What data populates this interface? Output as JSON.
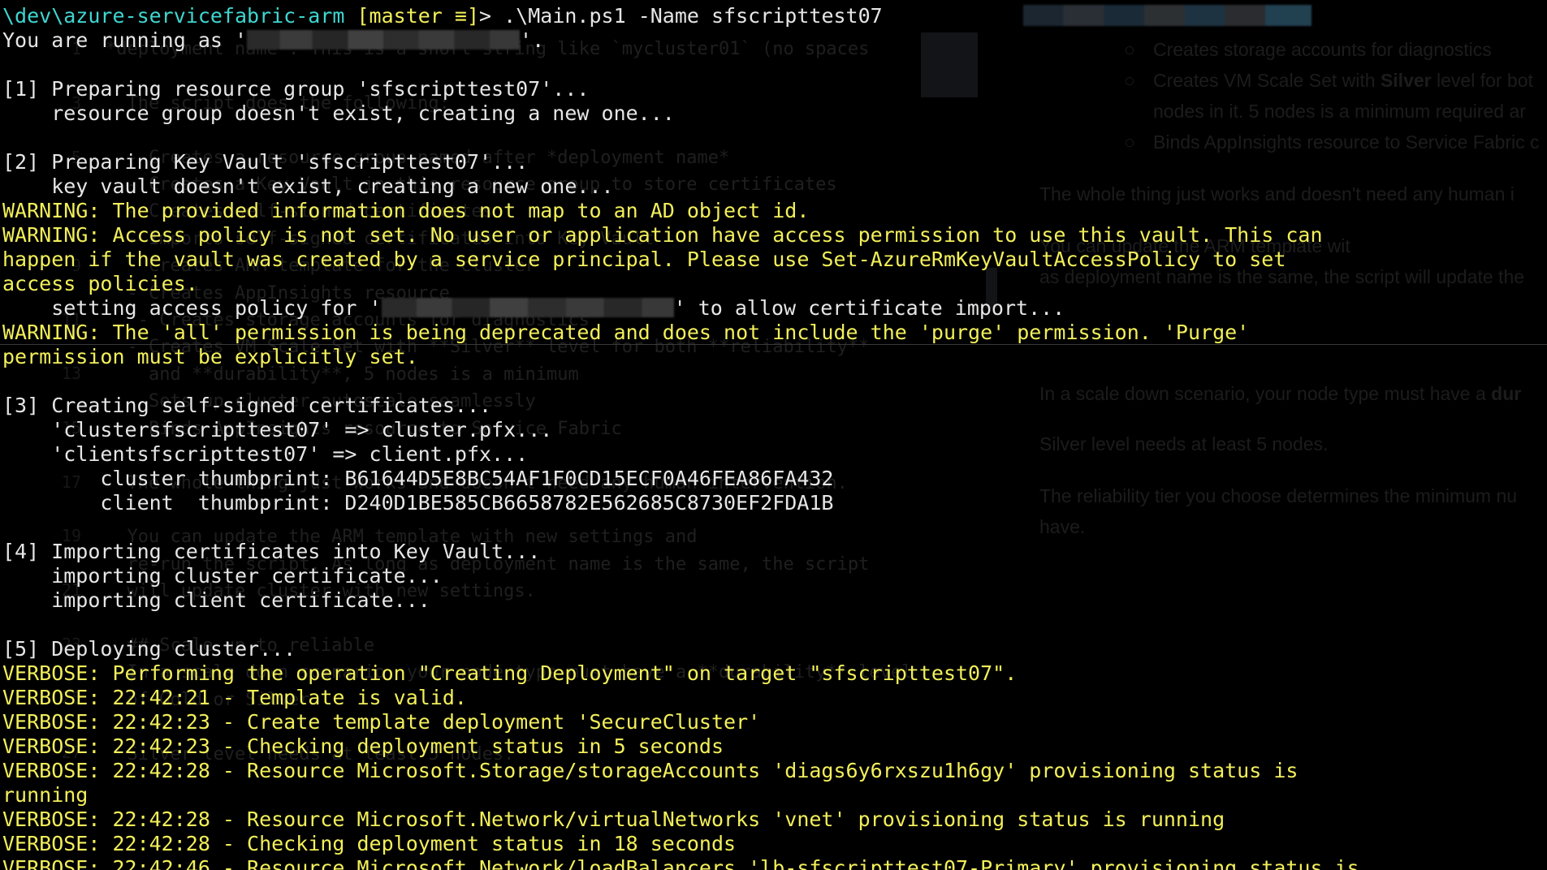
{
  "prompt": {
    "path": "\\dev\\azure-servicefabric-arm",
    "branch": "[master ≡]",
    "symbol": "> ",
    "command": ".\\Main.ps1 -Name sfscripttest07"
  },
  "lines": [
    {
      "id": "running-as",
      "kind": "plain",
      "before": "You are running as '",
      "redacted": true,
      "after": "'."
    },
    {
      "id": "blank-1",
      "kind": "plain",
      "text": ""
    },
    {
      "id": "step1-title",
      "kind": "plain",
      "text": "[1] Preparing resource group 'sfscripttest07'..."
    },
    {
      "id": "step1-msg",
      "kind": "plain",
      "text": "    resource group doesn't exist, creating a new one..."
    },
    {
      "id": "blank-2",
      "kind": "plain",
      "text": ""
    },
    {
      "id": "step2-title",
      "kind": "plain",
      "text": "[2] Preparing Key Vault 'sfscripttest07'..."
    },
    {
      "id": "step2-msg",
      "kind": "plain",
      "text": "    key vault doesn't exist, creating a new one..."
    },
    {
      "id": "warn-1",
      "kind": "warn",
      "text": "WARNING: The provided information does not map to an AD object id."
    },
    {
      "id": "warn-2a",
      "kind": "warn",
      "text": "WARNING: Access policy is not set. No user or application have access permission to use this vault. This can"
    },
    {
      "id": "warn-2b",
      "kind": "warn",
      "text": "happen if the vault was created by a service principal. Please use Set-AzureRmKeyVaultAccessPolicy to set"
    },
    {
      "id": "warn-2c",
      "kind": "warn",
      "text": "access policies."
    },
    {
      "id": "access-policy",
      "kind": "plain",
      "before": "    setting access policy for '",
      "redacted": true,
      "after": "' to allow certificate import..."
    },
    {
      "id": "warn-3a",
      "kind": "warn",
      "text": "WARNING: The 'all' permission is being deprecated and does not include the 'purge' permission. 'Purge'"
    },
    {
      "id": "warn-3b",
      "kind": "warn",
      "text": "permission must be explicitly set."
    },
    {
      "id": "blank-3",
      "kind": "plain",
      "text": ""
    },
    {
      "id": "step3-title",
      "kind": "plain",
      "text": "[3] Creating self-signed certificates..."
    },
    {
      "id": "step3-cluster",
      "kind": "plain",
      "text": "    'clustersfscripttest07' => cluster.pfx..."
    },
    {
      "id": "step3-client",
      "kind": "plain",
      "text": "    'clientsfscripttest07' => client.pfx..."
    },
    {
      "id": "thumb-cluster",
      "kind": "plain",
      "text": "        cluster thumbprint: B61644D5E8BC54AF1F0CD15ECF0A46FEA86FA432"
    },
    {
      "id": "thumb-client",
      "kind": "plain",
      "text": "        client  thumbprint: D240D1BE585CB6658782E562685C8730EF2FDA1B"
    },
    {
      "id": "blank-4",
      "kind": "plain",
      "text": ""
    },
    {
      "id": "step4-title",
      "kind": "plain",
      "text": "[4] Importing certificates into Key Vault..."
    },
    {
      "id": "step4-cluster",
      "kind": "plain",
      "text": "    importing cluster certificate..."
    },
    {
      "id": "step4-client",
      "kind": "plain",
      "text": "    importing client certificate..."
    },
    {
      "id": "blank-5",
      "kind": "plain",
      "text": ""
    },
    {
      "id": "step5-title",
      "kind": "plain",
      "text": "[5] Deploying cluster..."
    },
    {
      "id": "verbose-1",
      "kind": "verbose",
      "text": "VERBOSE: Performing the operation \"Creating Deployment\" on target \"sfscripttest07\"."
    },
    {
      "id": "verbose-2",
      "kind": "verbose",
      "text": "VERBOSE: 22:42:21 - Template is valid."
    },
    {
      "id": "verbose-3",
      "kind": "verbose",
      "text": "VERBOSE: 22:42:23 - Create template deployment 'SecureCluster'"
    },
    {
      "id": "verbose-4",
      "kind": "verbose",
      "text": "VERBOSE: 22:42:23 - Checking deployment status in 5 seconds"
    },
    {
      "id": "verbose-5a",
      "kind": "verbose",
      "text": "VERBOSE: 22:42:28 - Resource Microsoft.Storage/storageAccounts 'diags6y6rxszu1h6gy' provisioning status is"
    },
    {
      "id": "verbose-5b",
      "kind": "verbose",
      "text": "running"
    },
    {
      "id": "verbose-6",
      "kind": "verbose",
      "text": "VERBOSE: 22:42:28 - Resource Microsoft.Network/virtualNetworks 'vnet' provisioning status is running"
    },
    {
      "id": "verbose-7",
      "kind": "verbose",
      "text": "VERBOSE: 22:42:28 - Checking deployment status in 18 seconds"
    },
    {
      "id": "verbose-8",
      "kind": "verbose",
      "text": "VERBOSE: 22:42:46 - Resource Microsoft.Network/loadBalancers 'lb-sfscripttest07-Primary' provisioning status is"
    }
  ],
  "colors": {
    "background": "#000000",
    "text": "#e6e6e6",
    "warning": "#f2ef5a",
    "path": "#3fd6d0"
  },
  "icons": {
    "branch-status": "≡"
  }
}
